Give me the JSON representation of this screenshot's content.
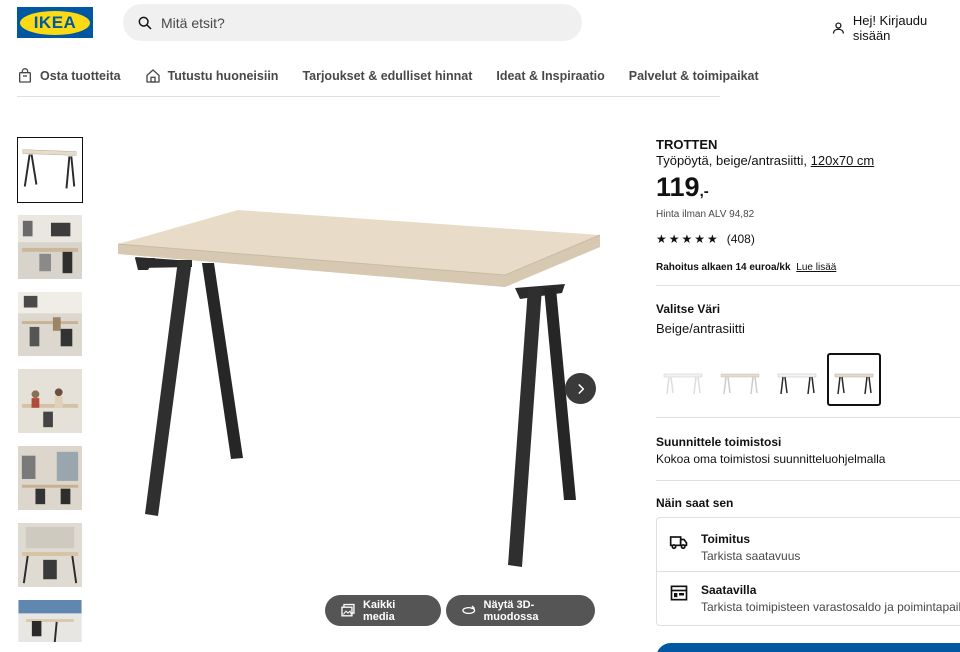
{
  "header": {
    "logo_text": "IKEA",
    "search_placeholder": "Mitä etsit?",
    "login_label": "Hej! Kirjaudu sisään"
  },
  "nav": [
    {
      "label": "Osta tuotteita",
      "icon": "shopping-bag-icon"
    },
    {
      "label": "Tutustu huoneisiin",
      "icon": "home-icon"
    },
    {
      "label": "Tarjoukset & edulliset hinnat"
    },
    {
      "label": "Ideat & Inspiraatio"
    },
    {
      "label": "Palvelut & toimipaikat"
    }
  ],
  "gallery": {
    "all_media_label": "Kaikki media",
    "view_3d_label": "Näytä 3D-muodossa"
  },
  "product": {
    "name": "TROTTEN",
    "description": "Työpöytä, beige/antrasiitti,",
    "size": "120x70 cm",
    "price": "119",
    "price_suffix": ",-",
    "vat_text": "Hinta ilman ALV 94,82",
    "stars": "★★★★★",
    "rating_count": "(408)",
    "finance_text": "Rahoitus alkaen 14 euroa/kk",
    "finance_link": "Lue lisää",
    "color_title": "Valitse Väri",
    "color_value": "Beige/antrasiitti",
    "plan_title": "Suunnittele toimistosi",
    "plan_text": "Kokoa oma toimistosi suunnitteluohjelmalla",
    "get_title": "Näin saat sen",
    "delivery_title": "Toimitus",
    "delivery_text": "Tarkista saatavuus",
    "store_title": "Saatavilla",
    "store_text": "Tarkista toimipisteen varastosaldo ja poimintapaikka"
  },
  "colors": {
    "brand_blue": "#0058a3",
    "brand_yellow": "#fbd914",
    "desk_top": "#e8dcc8",
    "desk_legs": "#2a2a2a"
  }
}
